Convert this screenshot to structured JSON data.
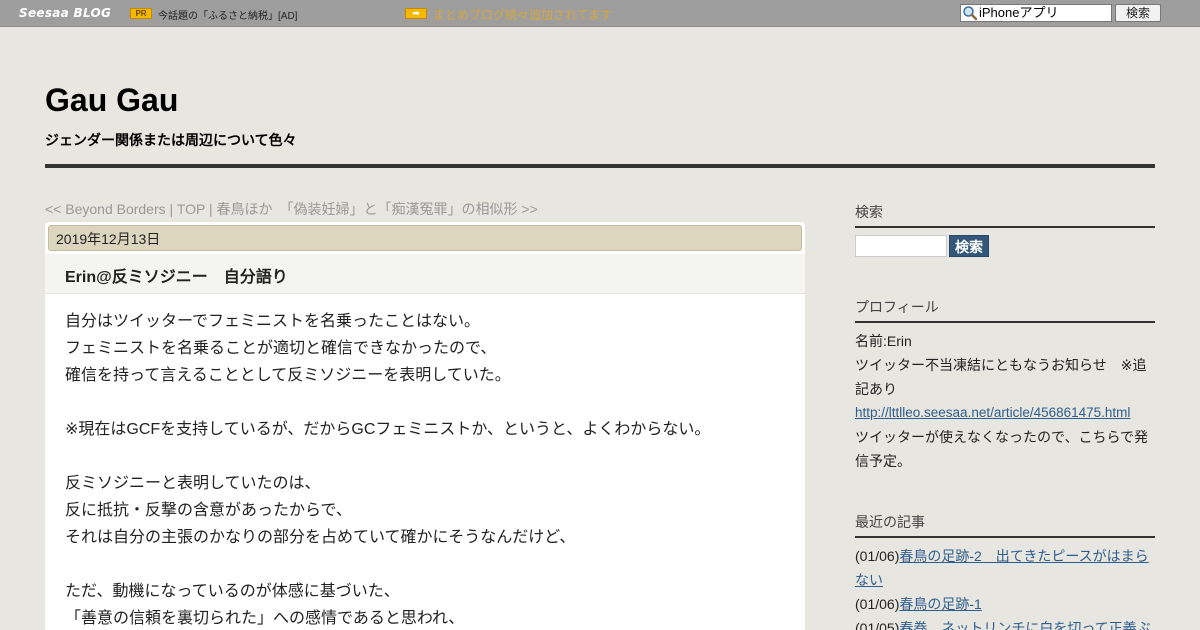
{
  "topbar": {
    "logo": "Seesaa BLOG",
    "pr_badge": "PR",
    "pr_text": "今話題の「ふるさと納税」[AD]",
    "arrow_badge": "➡",
    "matome_link": "まとめブログ続々追加されてます",
    "search_value": "iPhoneアプリ",
    "search_button": "検索"
  },
  "header": {
    "title": "Gau Gau",
    "description": "ジェンダー関係または周辺について色々"
  },
  "article_nav": {
    "prev": "<< Beyond Borders",
    "sep1": " | ",
    "top": "TOP",
    "sep2": " | ",
    "next": "春鳥ほか　「偽装妊婦」と「痴漢冤罪」の相似形 >>"
  },
  "article": {
    "date": "2019年12月13日",
    "title": "Erin@反ミソジニー　自分語り",
    "lines": [
      "自分はツイッターでフェミニストを名乗ったことはない。",
      "フェミニストを名乗ることが適切と確信できなかったので、",
      "確信を持って言えることとして反ミソジニーを表明していた。",
      "",
      "※現在はGCFを支持しているが、だからGCフェミニストか、というと、よくわからない。",
      "",
      "反ミソジニーと表明していたのは、",
      "反に抵抗・反撃の含意があったからで、",
      "それは自分の主張のかなりの部分を占めていて確かにそうなんだけど、",
      "",
      "ただ、動機になっているのが体感に基づいた、",
      "「善意の信頼を裏切られた」への感情であると思われ、"
    ]
  },
  "sidebar": {
    "search_heading": "検索",
    "search_button": "検索",
    "profile_heading": "プロフィール",
    "profile_name": "名前:Erin",
    "profile_line1": "ツイッター不当凍結にともなうお知らせ　※追",
    "profile_line2": "記あり",
    "profile_link": "http://lttlleo.seesaa.net/article/456861475.html",
    "profile_line3": "ツイッターが使えなくなったので、こちらで発",
    "profile_line4": "信予定。",
    "recent_heading": "最近の記事",
    "recent": [
      {
        "date": "(01/06)",
        "title_line1": "春鳥の足跡-2　出てきたピースがはまら",
        "title_line2": "ない"
      },
      {
        "date": "(01/06)",
        "title_line1": "春鳥の足跡-1",
        "title_line2": ""
      },
      {
        "date": "(01/05)",
        "title_line1": "春巻　ネットリンチに白を切って正義ぶ",
        "title_line2": ""
      }
    ]
  },
  "colors": {
    "topbar_bg": "#9e9e9e",
    "page_bg": "#e8e6e1",
    "date_bar_bg": "#dcd6bf",
    "link": "#2e5e8e",
    "accent_badge": "#f5b800",
    "search_button_bg": "#33577a"
  }
}
